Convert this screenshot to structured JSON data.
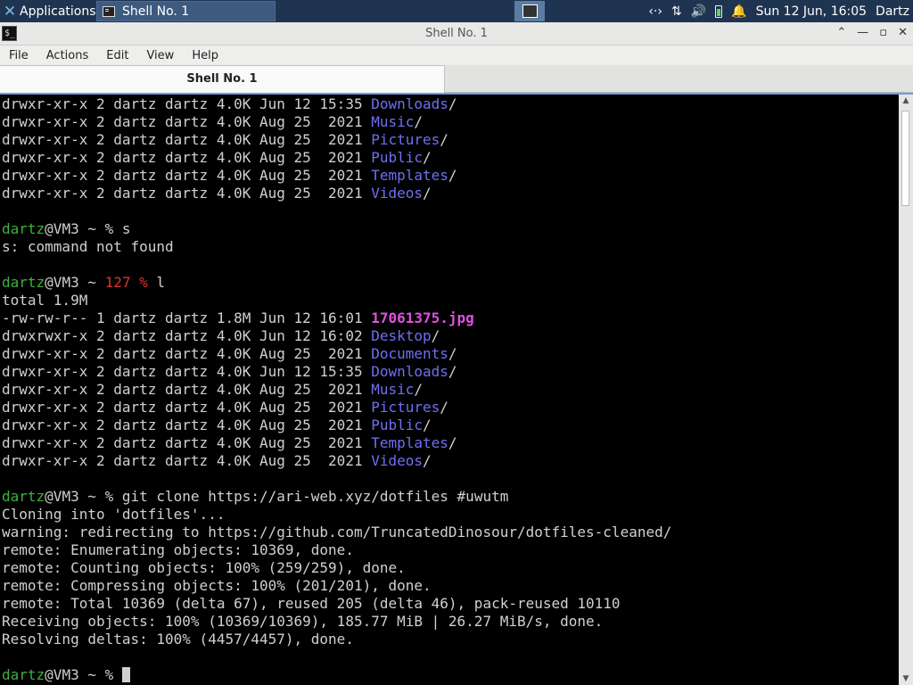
{
  "panel": {
    "applications_label": "Applications",
    "task_label": "Shell No. 1",
    "clock": "Sun 12 Jun, 16:05",
    "user": "Dartz"
  },
  "window": {
    "title": "Shell No. 1",
    "menu": [
      "File",
      "Actions",
      "Edit",
      "View",
      "Help"
    ],
    "tab_label": "Shell No. 1"
  },
  "terminal": {
    "lines": [
      [
        {
          "t": "drwxr-xr-x 2 dartz dartz 4.0K Jun 12 15:35 "
        },
        {
          "t": "Downloads",
          "c": "dir"
        },
        {
          "t": "/"
        }
      ],
      [
        {
          "t": "drwxr-xr-x 2 dartz dartz 4.0K Aug 25  2021 "
        },
        {
          "t": "Music",
          "c": "dir"
        },
        {
          "t": "/"
        }
      ],
      [
        {
          "t": "drwxr-xr-x 2 dartz dartz 4.0K Aug 25  2021 "
        },
        {
          "t": "Pictures",
          "c": "dir"
        },
        {
          "t": "/"
        }
      ],
      [
        {
          "t": "drwxr-xr-x 2 dartz dartz 4.0K Aug 25  2021 "
        },
        {
          "t": "Public",
          "c": "dir"
        },
        {
          "t": "/"
        }
      ],
      [
        {
          "t": "drwxr-xr-x 2 dartz dartz 4.0K Aug 25  2021 "
        },
        {
          "t": "Templates",
          "c": "dir"
        },
        {
          "t": "/"
        }
      ],
      [
        {
          "t": "drwxr-xr-x 2 dartz dartz 4.0K Aug 25  2021 "
        },
        {
          "t": "Videos",
          "c": "dir"
        },
        {
          "t": "/"
        }
      ],
      [],
      [
        {
          "t": "dartz",
          "c": "user"
        },
        {
          "t": "@VM3 ~ % s"
        }
      ],
      [
        {
          "t": "s: command not found"
        }
      ],
      [],
      [
        {
          "t": "dartz",
          "c": "user"
        },
        {
          "t": "@VM3 ~ "
        },
        {
          "t": "127 %",
          "c": "err"
        },
        {
          "t": " l"
        }
      ],
      [
        {
          "t": "total 1.9M"
        }
      ],
      [
        {
          "t": "-rw-rw-r-- 1 dartz dartz 1.8M Jun 12 16:01 "
        },
        {
          "t": "17061375.jpg",
          "c": "img"
        }
      ],
      [
        {
          "t": "drwxrwxr-x 2 dartz dartz 4.0K Jun 12 16:02 "
        },
        {
          "t": "Desktop",
          "c": "dir"
        },
        {
          "t": "/"
        }
      ],
      [
        {
          "t": "drwxr-xr-x 2 dartz dartz 4.0K Aug 25  2021 "
        },
        {
          "t": "Documents",
          "c": "dir"
        },
        {
          "t": "/"
        }
      ],
      [
        {
          "t": "drwxr-xr-x 2 dartz dartz 4.0K Jun 12 15:35 "
        },
        {
          "t": "Downloads",
          "c": "dir"
        },
        {
          "t": "/"
        }
      ],
      [
        {
          "t": "drwxr-xr-x 2 dartz dartz 4.0K Aug 25  2021 "
        },
        {
          "t": "Music",
          "c": "dir"
        },
        {
          "t": "/"
        }
      ],
      [
        {
          "t": "drwxr-xr-x 2 dartz dartz 4.0K Aug 25  2021 "
        },
        {
          "t": "Pictures",
          "c": "dir"
        },
        {
          "t": "/"
        }
      ],
      [
        {
          "t": "drwxr-xr-x 2 dartz dartz 4.0K Aug 25  2021 "
        },
        {
          "t": "Public",
          "c": "dir"
        },
        {
          "t": "/"
        }
      ],
      [
        {
          "t": "drwxr-xr-x 2 dartz dartz 4.0K Aug 25  2021 "
        },
        {
          "t": "Templates",
          "c": "dir"
        },
        {
          "t": "/"
        }
      ],
      [
        {
          "t": "drwxr-xr-x 2 dartz dartz 4.0K Aug 25  2021 "
        },
        {
          "t": "Videos",
          "c": "dir"
        },
        {
          "t": "/"
        }
      ],
      [],
      [
        {
          "t": "dartz",
          "c": "user"
        },
        {
          "t": "@VM3 ~ % git clone https://ari-web.xyz/dotfiles #uwutm"
        }
      ],
      [
        {
          "t": "Cloning into 'dotfiles'..."
        }
      ],
      [
        {
          "t": "warning: redirecting to https://github.com/TruncatedDinosour/dotfiles-cleaned/"
        }
      ],
      [
        {
          "t": "remote: Enumerating objects: 10369, done."
        }
      ],
      [
        {
          "t": "remote: Counting objects: 100% (259/259), done."
        }
      ],
      [
        {
          "t": "remote: Compressing objects: 100% (201/201), done."
        }
      ],
      [
        {
          "t": "remote: Total 10369 (delta 67), reused 205 (delta 46), pack-reused 10110"
        }
      ],
      [
        {
          "t": "Receiving objects: 100% (10369/10369), 185.77 MiB | 26.27 MiB/s, done."
        }
      ],
      [
        {
          "t": "Resolving deltas: 100% (4457/4457), done."
        }
      ],
      [],
      [
        {
          "t": "dartz",
          "c": "user"
        },
        {
          "t": "@VM3 ~ % "
        },
        {
          "t": "",
          "c": "cursor"
        }
      ]
    ]
  }
}
